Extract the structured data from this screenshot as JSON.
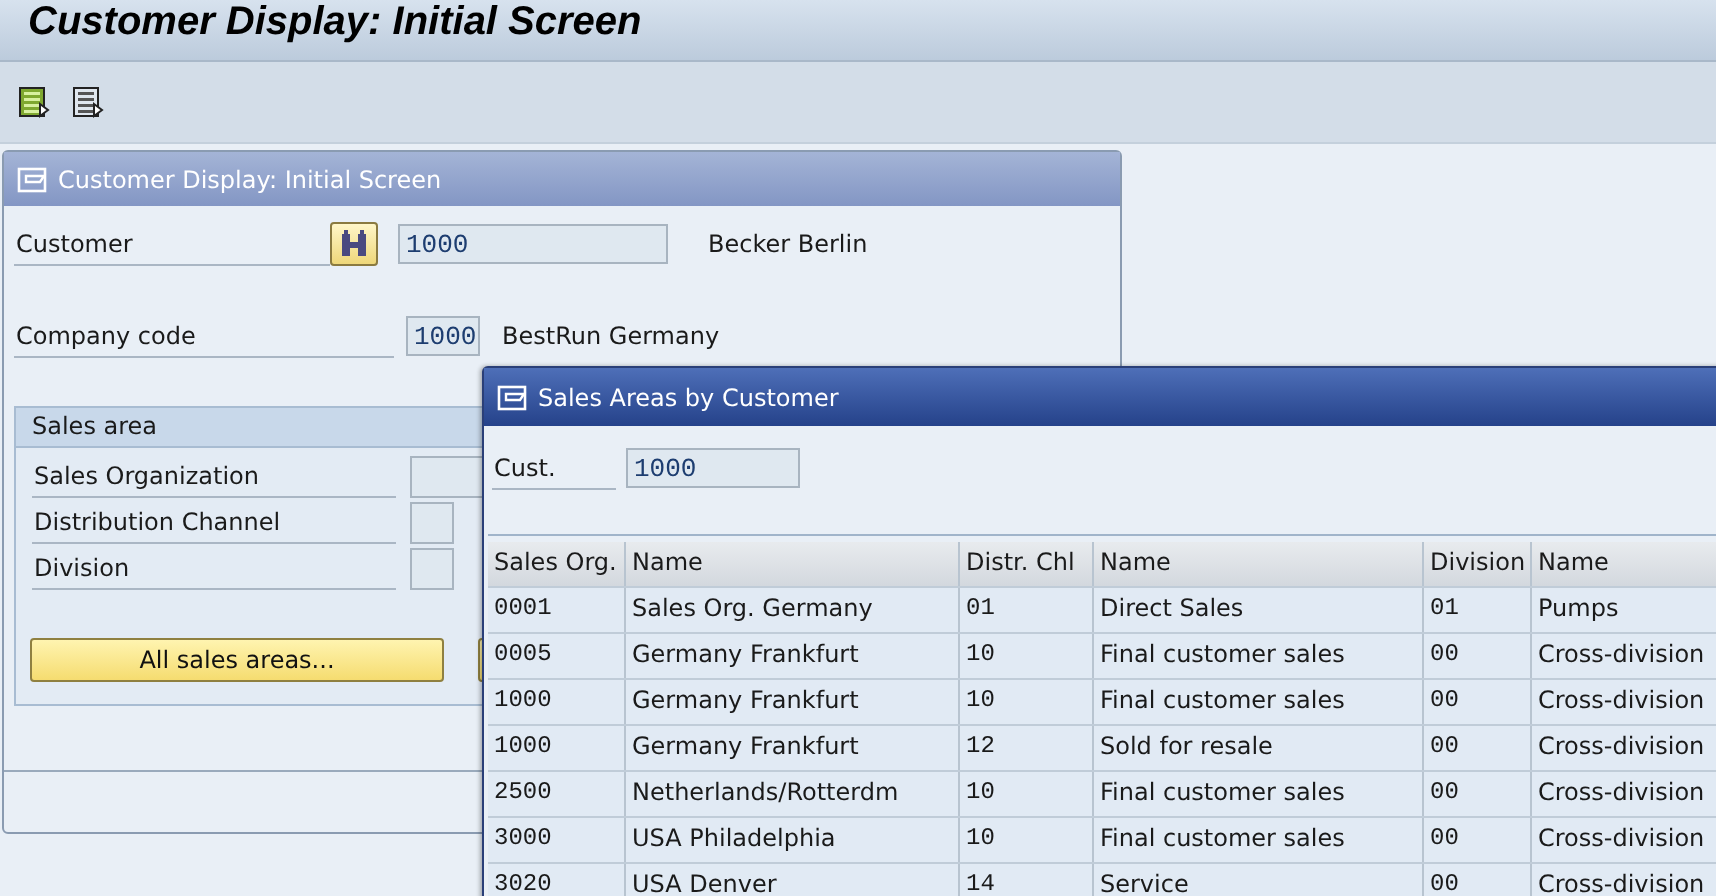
{
  "window": {
    "title": "Customer Display: Initial Screen"
  },
  "toolbar": {
    "buttons": [
      {
        "kind": "green"
      },
      {
        "kind": "plain"
      }
    ]
  },
  "panel": {
    "title": "Customer Display: Initial Screen",
    "customer": {
      "label": "Customer",
      "value": "1000",
      "description": "Becker Berlin"
    },
    "company_code": {
      "label": "Company code",
      "value": "1000",
      "description": "BestRun Germany"
    },
    "sales_area": {
      "title": "Sales area",
      "fields": [
        {
          "label": "Sales Organization",
          "kind": "wide"
        },
        {
          "label": "Distribution Channel",
          "kind": "narrow"
        },
        {
          "label": "Division",
          "kind": "narrow"
        }
      ],
      "button": "All sales areas..."
    }
  },
  "popup": {
    "title": "Sales Areas by Customer",
    "cust": {
      "label": "Cust.",
      "value": "1000"
    },
    "table": {
      "columns": [
        "Sales Org.",
        "Name",
        "Distr. Chl",
        "Name",
        "Division",
        "Name"
      ],
      "rows": [
        [
          "0001",
          "Sales Org. Germany",
          "01",
          "Direct Sales",
          "01",
          "Pumps"
        ],
        [
          "0005",
          "Germany Frankfurt",
          "10",
          "Final customer sales",
          "00",
          "Cross-division"
        ],
        [
          "1000",
          "Germany Frankfurt",
          "10",
          "Final customer sales",
          "00",
          "Cross-division"
        ],
        [
          "1000",
          "Germany Frankfurt",
          "12",
          "Sold for resale",
          "00",
          "Cross-division"
        ],
        [
          "2500",
          "Netherlands/Rotterdm",
          "10",
          "Final customer sales",
          "00",
          "Cross-division"
        ],
        [
          "3000",
          "USA Philadelphia",
          "10",
          "Final customer sales",
          "00",
          "Cross-division"
        ],
        [
          "3020",
          "USA Denver",
          "14",
          "Service",
          "00",
          "Cross-division"
        ]
      ]
    }
  }
}
